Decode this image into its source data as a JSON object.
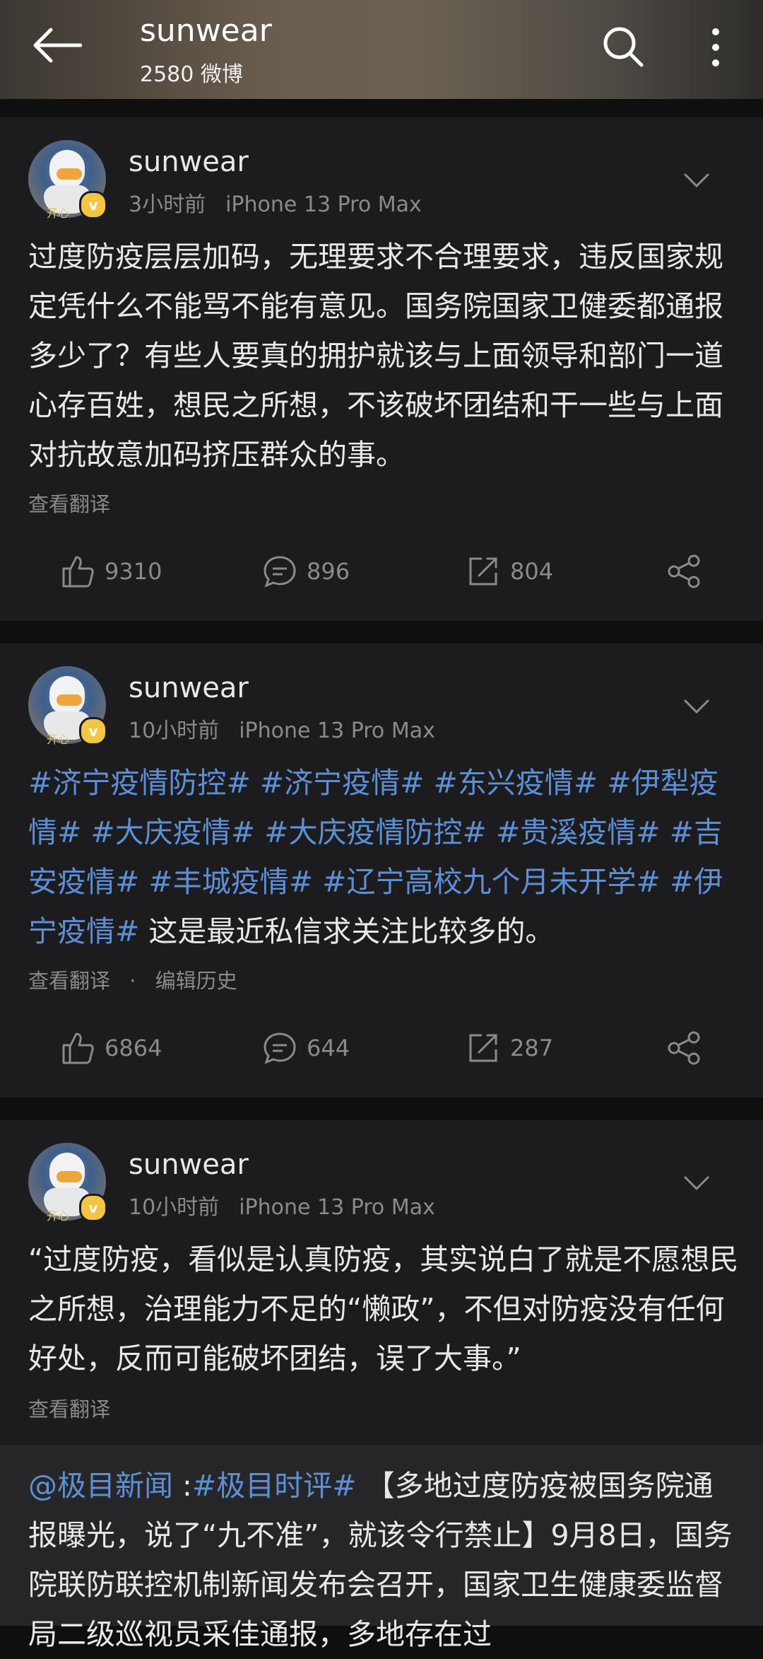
{
  "header": {
    "title": "sunwear",
    "subtitle": "2580 微博"
  },
  "posts": [
    {
      "user": "sunwear",
      "avatar_tag": "开心",
      "time": "3小时前",
      "device": "iPhone 13 Pro Max",
      "text": "过度防疫层层加码，无理要求不合理要求，违反国家规定凭什么不能骂不能有意见。国务院国家卫健委都通报多少了？有些人要真的拥护就该与上面领导和部门一道心存百姓，想民之所想，不该破坏团结和干一些与上面对抗故意加码挤压群众的事。",
      "translate": "查看翻译",
      "likes": "9310",
      "comments": "896",
      "reposts": "804"
    },
    {
      "user": "sunwear",
      "avatar_tag": "开心",
      "time": "10小时前",
      "device": "iPhone 13 Pro Max",
      "hashtags": [
        "#济宁疫情防控#",
        "#济宁疫情#",
        "#东兴疫情#",
        "#伊犁疫情#",
        "#大庆疫情#",
        "#大庆疫情防控#",
        "#贵溪疫情#",
        "#吉安疫情#",
        "#丰城疫情#",
        "#辽宁高校九个月未开学#",
        "#伊宁疫情#"
      ],
      "text_tail": "这是最近私信求关注比较多的。",
      "translate": "查看翻译",
      "dot": "·",
      "edit_history": "编辑历史",
      "likes": "6864",
      "comments": "644",
      "reposts": "287"
    },
    {
      "user": "sunwear",
      "avatar_tag": "开心",
      "time": "10小时前",
      "device": "iPhone 13 Pro Max",
      "text": "“过度防疫，看似是认真防疫，其实说白了就是不愿想民之所想，治理能力不足的“懒政”，不但对防疫没有任何好处，反而可能破坏团结，误了大事。”",
      "translate": "查看翻译",
      "quote": {
        "mention": "@极目新闻",
        "colon": " :",
        "hashtag": "#极目时评#",
        "text": " 【多地过度防疫被国务院通报曝光，说了“九不准”，就该令行禁止】9月8日，国务院联防联控机制新闻发布会召开，国家卫生健康委监督局二级巡视员采佳通报，多地存在过"
      }
    }
  ],
  "icons": [
    "back-arrow-icon",
    "search-icon",
    "more-vertical-icon",
    "chevron-down-icon",
    "like-icon",
    "comment-icon",
    "repost-icon",
    "share-icon",
    "verified-badge-icon"
  ]
}
